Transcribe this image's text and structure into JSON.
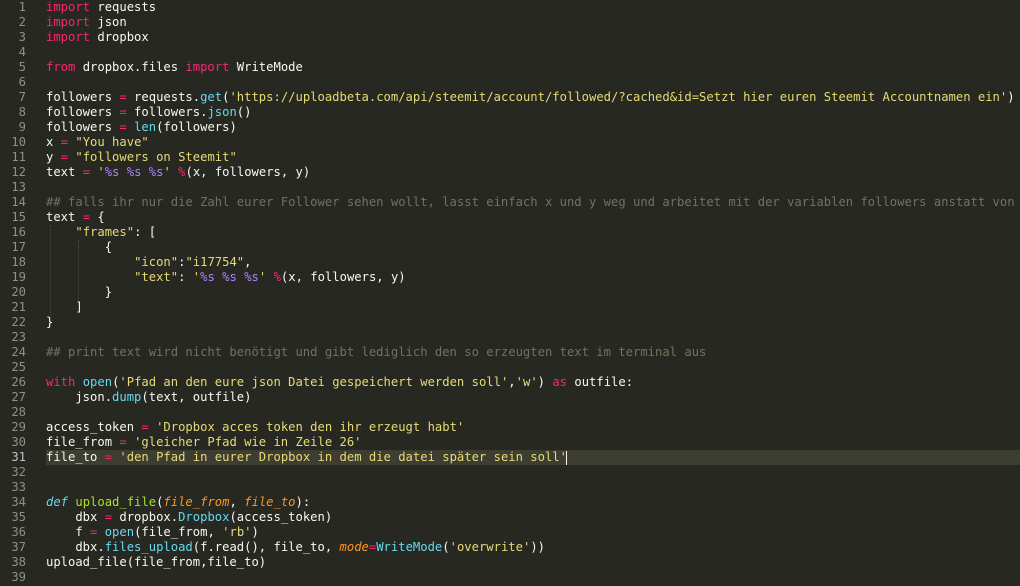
{
  "editor": {
    "language": "python",
    "theme": "monokai",
    "active_line": 31,
    "colors": {
      "background": "#272822",
      "foreground": "#f8f8f2",
      "keyword": "#f92672",
      "string": "#e6db74",
      "builtin": "#66d9ef",
      "comment": "#75715e",
      "function": "#a6e22e",
      "parameter": "#fd971f"
    },
    "lines": [
      [
        [
          "k",
          "import"
        ],
        [
          "t",
          " requests"
        ]
      ],
      [
        [
          "k",
          "import"
        ],
        [
          "t",
          " json"
        ]
      ],
      [
        [
          "k",
          "import"
        ],
        [
          "t",
          " dropbox"
        ]
      ],
      [],
      [
        [
          "k",
          "from"
        ],
        [
          "t",
          " dropbox.files "
        ],
        [
          "k",
          "import"
        ],
        [
          "t",
          " WriteMode"
        ]
      ],
      [],
      [
        [
          "t",
          "followers "
        ],
        [
          "k",
          "="
        ],
        [
          "t",
          " requests."
        ],
        [
          "b",
          "get"
        ],
        [
          "t",
          "("
        ],
        [
          "s",
          "'https://uploadbeta.com/api/steemit/account/followed/?cached&id=Setzt hier euren Steemit Accountnamen ein'"
        ],
        [
          "t",
          ")"
        ]
      ],
      [
        [
          "t",
          "followers "
        ],
        [
          "k",
          "="
        ],
        [
          "t",
          " followers."
        ],
        [
          "b",
          "json"
        ],
        [
          "t",
          "()"
        ]
      ],
      [
        [
          "t",
          "followers "
        ],
        [
          "k",
          "="
        ],
        [
          "t",
          " "
        ],
        [
          "b",
          "len"
        ],
        [
          "t",
          "(followers)"
        ]
      ],
      [
        [
          "t",
          "x "
        ],
        [
          "k",
          "="
        ],
        [
          "t",
          " "
        ],
        [
          "s",
          "\"You have\""
        ]
      ],
      [
        [
          "t",
          "y "
        ],
        [
          "k",
          "="
        ],
        [
          "t",
          " "
        ],
        [
          "s",
          "\"followers on Steemit\""
        ]
      ],
      [
        [
          "t",
          "text "
        ],
        [
          "k",
          "="
        ],
        [
          "t",
          " "
        ],
        [
          "s",
          "'"
        ],
        [
          "n",
          "%s"
        ],
        [
          "s",
          " "
        ],
        [
          "n",
          "%s"
        ],
        [
          "s",
          " "
        ],
        [
          "n",
          "%s"
        ],
        [
          "s",
          "'"
        ],
        [
          "t",
          " "
        ],
        [
          "k",
          "%"
        ],
        [
          "t",
          "(x, followers, y)"
        ]
      ],
      [],
      [
        [
          "c",
          "## falls ihr nur die Zahl eurer Follower sehen wollt, lasst einfach x und y weg und arbeitet mit der variablen followers anstatt von text"
        ]
      ],
      [
        [
          "t",
          "text "
        ],
        [
          "k",
          "="
        ],
        [
          "t",
          " {"
        ]
      ],
      [
        [
          "t",
          "    "
        ],
        [
          "s",
          "\"frames\""
        ],
        [
          "t",
          ": ["
        ]
      ],
      [
        [
          "t",
          "        {"
        ]
      ],
      [
        [
          "t",
          "            "
        ],
        [
          "s",
          "\"icon\""
        ],
        [
          "t",
          ":"
        ],
        [
          "s",
          "\"i17754\""
        ],
        [
          "t",
          ","
        ]
      ],
      [
        [
          "t",
          "            "
        ],
        [
          "s",
          "\"text\""
        ],
        [
          "t",
          ": "
        ],
        [
          "s",
          "'"
        ],
        [
          "n",
          "%s"
        ],
        [
          "s",
          " "
        ],
        [
          "n",
          "%s"
        ],
        [
          "s",
          " "
        ],
        [
          "n",
          "%s"
        ],
        [
          "s",
          "'"
        ],
        [
          "t",
          " "
        ],
        [
          "k",
          "%"
        ],
        [
          "t",
          "(x, followers, y)"
        ]
      ],
      [
        [
          "t",
          "        }"
        ]
      ],
      [
        [
          "t",
          "    ]"
        ]
      ],
      [
        [
          "t",
          "}"
        ]
      ],
      [],
      [
        [
          "c",
          "## print text wird nicht benötigt und gibt lediglich den so erzeugten text im terminal aus"
        ]
      ],
      [],
      [
        [
          "k",
          "with"
        ],
        [
          "t",
          " "
        ],
        [
          "b",
          "open"
        ],
        [
          "t",
          "("
        ],
        [
          "s",
          "'Pfad an den eure json Datei gespeichert werden soll'"
        ],
        [
          "t",
          ","
        ],
        [
          "s",
          "'w'"
        ],
        [
          "t",
          ") "
        ],
        [
          "k",
          "as"
        ],
        [
          "t",
          " outfile:"
        ]
      ],
      [
        [
          "t",
          "    json."
        ],
        [
          "b",
          "dump"
        ],
        [
          "t",
          "(text, outfile)"
        ]
      ],
      [],
      [
        [
          "t",
          "access_token "
        ],
        [
          "k",
          "="
        ],
        [
          "t",
          " "
        ],
        [
          "s",
          "'Dropbox acces token den ihr erzeugt habt'"
        ]
      ],
      [
        [
          "t",
          "file_from "
        ],
        [
          "k",
          "="
        ],
        [
          "t",
          " "
        ],
        [
          "s",
          "'gleicher Pfad wie in Zeile 26'"
        ]
      ],
      [
        [
          "t",
          "file_to "
        ],
        [
          "k",
          "="
        ],
        [
          "t",
          " "
        ],
        [
          "s",
          "'den Pfad in eurer Dropbox in dem die datei später sein soll'"
        ],
        [
          "cursor",
          ""
        ]
      ],
      [],
      [],
      [
        [
          "d",
          "def"
        ],
        [
          "t",
          " "
        ],
        [
          "fn",
          "upload_file"
        ],
        [
          "t",
          "("
        ],
        [
          "p",
          "file_from"
        ],
        [
          "t",
          ", "
        ],
        [
          "p",
          "file_to"
        ],
        [
          "t",
          "):"
        ]
      ],
      [
        [
          "t",
          "    dbx "
        ],
        [
          "k",
          "="
        ],
        [
          "t",
          " dropbox."
        ],
        [
          "b",
          "Dropbox"
        ],
        [
          "t",
          "(access_token)"
        ]
      ],
      [
        [
          "t",
          "    f "
        ],
        [
          "k",
          "="
        ],
        [
          "t",
          " "
        ],
        [
          "b",
          "open"
        ],
        [
          "t",
          "(file_from, "
        ],
        [
          "s",
          "'rb'"
        ],
        [
          "t",
          ")"
        ]
      ],
      [
        [
          "t",
          "    dbx."
        ],
        [
          "b",
          "files_upload"
        ],
        [
          "t",
          "(f.read(), file_to, "
        ],
        [
          "p",
          "mode"
        ],
        [
          "k",
          "="
        ],
        [
          "b",
          "WriteMode"
        ],
        [
          "t",
          "("
        ],
        [
          "s",
          "'overwrite'"
        ],
        [
          "t",
          "))"
        ]
      ],
      [
        [
          "t",
          "upload_file(file_from,file_to)"
        ]
      ],
      []
    ]
  }
}
